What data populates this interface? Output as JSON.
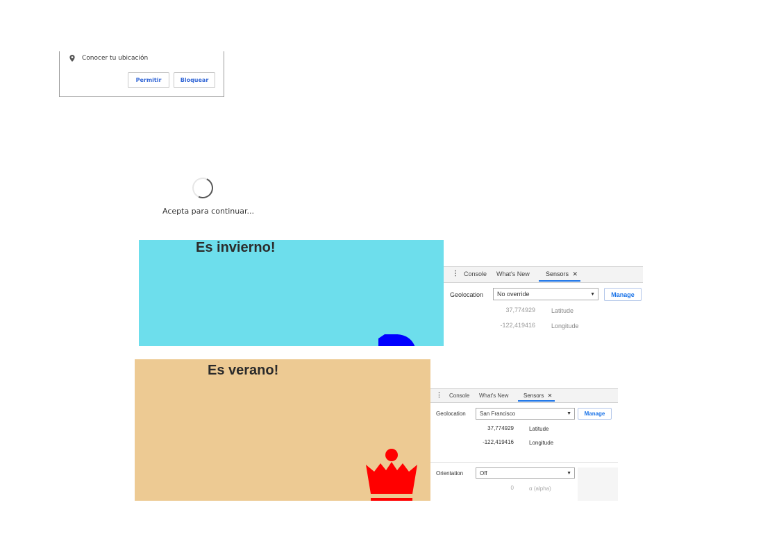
{
  "permission_prompt": {
    "item_label": "Conocer tu ubicación",
    "allow_label": "Permitir",
    "block_label": "Bloquear"
  },
  "loading": {
    "message": "Acepta para continuar..."
  },
  "winter_panel": {
    "title": "Es invierno!",
    "background": "#6ddeec",
    "figure_color": "#0000ff"
  },
  "summer_panel": {
    "title": "Es verano!",
    "background": "#edca93",
    "figure_color": "#ff0000"
  },
  "devtools_top": {
    "tabs": [
      "Console",
      "What's New",
      "Sensors"
    ],
    "active_tab": "Sensors",
    "geolocation_label": "Geolocation",
    "geolocation_value": "No override",
    "manage_label": "Manage",
    "latitude_value": "37,774929",
    "latitude_label": "Latitude",
    "longitude_value": "-122,419416",
    "longitude_label": "Longitude"
  },
  "devtools_bottom": {
    "tabs": [
      "Console",
      "What's New",
      "Sensors"
    ],
    "active_tab": "Sensors",
    "geolocation_label": "Geolocation",
    "geolocation_value": "San Francisco",
    "manage_label": "Manage",
    "latitude_value": "37,774929",
    "latitude_label": "Latitude",
    "longitude_value": "-122,419416",
    "longitude_label": "Longitude",
    "orientation_label": "Orientation",
    "orientation_value": "Off",
    "alpha_value": "0",
    "alpha_label": "α (alpha)"
  },
  "accent_color": "#1a73e8"
}
